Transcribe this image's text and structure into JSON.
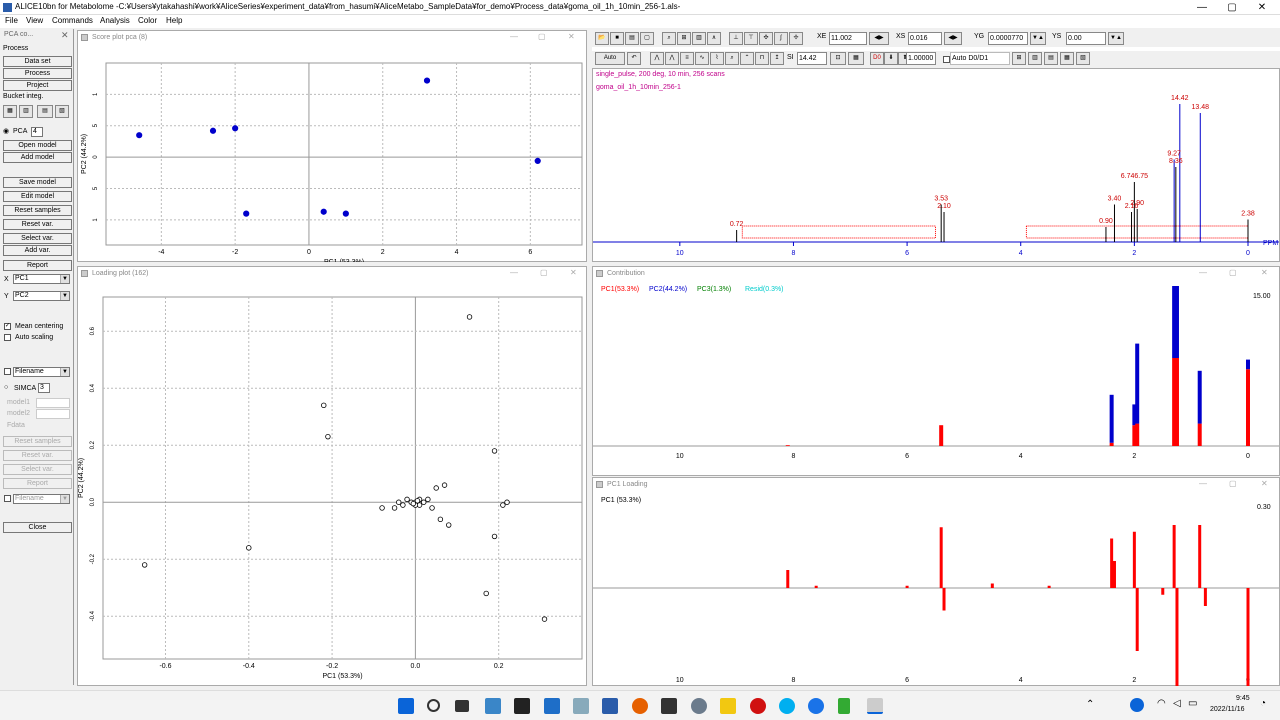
{
  "app": {
    "title": "ALICE10bn for Metabolome -C:¥Users¥ytakahashi¥work¥AliceSeries¥experiment_data¥from_hasumi¥AliceMetabo_SampleData¥for_demo¥Process_data¥goma_oil_1h_10min_256-1.als-"
  },
  "window_controls": {
    "minimize": "—",
    "maximize": "▢",
    "close": "✕"
  },
  "menu": [
    "File",
    "View",
    "Commands",
    "Analysis",
    "Color",
    "Help"
  ],
  "left_panel": {
    "title": "PCA co...",
    "process_label": "Process",
    "btn_dataset": "Data set",
    "btn_process": "Process",
    "btn_project": "Project",
    "bucket_label": "Bucket integ.",
    "pca_label": "PCA",
    "pca_value": "4",
    "btn_open_model": "Open model",
    "btn_add_model": "Add model",
    "btn_save_model": "Save model",
    "btn_edit_model": "Edit model",
    "btn_reset_samples": "Reset samples",
    "btn_reset_var": "Reset var.",
    "btn_select_var": "Select var.",
    "btn_add_var": "Add var.",
    "btn_report": "Report",
    "x_label": "X",
    "x_value": "PC1",
    "y_label": "Y",
    "y_value": "PC2",
    "mean_centering": "Mean centering",
    "auto_scaling": "Auto scaling",
    "filename1": "Filename",
    "simca_label": "SIMCA",
    "simca_value": "3",
    "model1": "model1",
    "model2": "model2",
    "fdata": "Fdata",
    "btn_reset_samples2": "Reset samples",
    "btn_reset_var2": "Reset var.",
    "btn_select_var2": "Select var.",
    "btn_report2": "Report",
    "filename2": "Filename",
    "btn_close": "Close"
  },
  "score_plot": {
    "title": "Score plot pca (8)",
    "chart_data": {
      "type": "scatter",
      "xlabel": "PC1 (53.3%)",
      "ylabel": "PC2 (44.2%)",
      "xlim": [
        -5.5,
        7.4
      ],
      "ylim": [
        -1.4,
        1.5
      ],
      "xticks": [
        -4,
        -2,
        0,
        2,
        4,
        6
      ],
      "yticks": [
        1,
        0.5,
        0,
        -0.5,
        -1
      ],
      "ytick_labels": [
        "1",
        "5",
        "0",
        "5",
        "1"
      ],
      "points": [
        [
          3.2,
          1.22
        ],
        [
          -4.6,
          0.35
        ],
        [
          -2.6,
          0.42
        ],
        [
          -2.0,
          0.46
        ],
        [
          6.2,
          -0.06
        ],
        [
          -1.7,
          -0.9
        ],
        [
          0.4,
          -0.87
        ],
        [
          1.0,
          -0.9
        ]
      ],
      "color": "#0000cc"
    }
  },
  "loading_plot": {
    "title": "Loading plot (162)",
    "chart_data": {
      "type": "scatter",
      "xlabel": "PC1 (53.3%)",
      "ylabel": "PC2 (44.2%)",
      "xlim": [
        -0.75,
        0.4
      ],
      "ylim": [
        -0.55,
        0.72
      ],
      "xticks": [
        -0.6,
        -0.4,
        -0.2,
        0.0,
        0.2
      ],
      "xtick_labels": [
        "-0.6",
        "-0.4",
        "-0.2",
        "0.0",
        "0.2"
      ],
      "yticks": [
        0.6,
        0.4,
        0.2,
        0.0,
        -0.2,
        -0.4
      ],
      "ytick_labels": [
        "0.6",
        "0.4",
        "0.2",
        "0.0",
        "-0.2",
        "-0.4"
      ],
      "points": [
        [
          0.13,
          0.65
        ],
        [
          -0.22,
          0.34
        ],
        [
          -0.21,
          0.23
        ],
        [
          0.19,
          0.18
        ],
        [
          -0.4,
          -0.16
        ],
        [
          -0.65,
          -0.22
        ],
        [
          0.19,
          -0.12
        ],
        [
          0.17,
          -0.32
        ],
        [
          0.31,
          -0.41
        ],
        [
          0.07,
          0.06
        ],
        [
          0.05,
          0.05
        ],
        [
          0.22,
          0.0
        ],
        [
          0.21,
          -0.01
        ],
        [
          0.08,
          -0.08
        ],
        [
          0.06,
          -0.06
        ],
        [
          0.04,
          -0.02
        ],
        [
          0.03,
          0.01
        ],
        [
          0.02,
          0.0
        ],
        [
          0.01,
          -0.01
        ],
        [
          0.0,
          0.0
        ],
        [
          -0.01,
          0.0
        ],
        [
          -0.02,
          0.01
        ],
        [
          -0.03,
          -0.01
        ],
        [
          -0.05,
          -0.02
        ],
        [
          -0.08,
          -0.02
        ],
        [
          -0.04,
          0.0
        ],
        [
          0.01,
          0.01
        ],
        [
          0.0,
          -0.01
        ],
        [
          0.005,
          0.005
        ],
        [
          -0.005,
          -0.005
        ]
      ]
    }
  },
  "toolbar": {
    "xe_label": "XE",
    "xe_value": "11.002",
    "xs_label": "XS",
    "xs_value": "0.016",
    "yg_label": "YG",
    "yg_value": "0.0000770",
    "ys_label": "YS",
    "ys_value": "0.00",
    "auto_label": "Auto",
    "scale_value": "14.42",
    "factor_value": "1.00000",
    "auto_d0": "Auto D0/D1",
    "d0": "D0"
  },
  "spectrum": {
    "line1": "single_pulse,  200 deg,  10 min, 256 scans",
    "line2": "goma_oil_1h_10min_256-1",
    "ppm_label": "PPM",
    "xticks": [
      10,
      8,
      6,
      4,
      2,
      0
    ],
    "peaks": [
      {
        "ppm": 1.2,
        "label": "14.42",
        "h": 0.92
      },
      {
        "ppm": 0.84,
        "label": "13.48",
        "h": 0.86
      },
      {
        "ppm": 1.3,
        "label": "9.27",
        "h": 0.55
      },
      {
        "ppm": 1.27,
        "label": "8.36",
        "h": 0.5
      },
      {
        "ppm": 2.0,
        "label": "6.746.75",
        "h": 0.4
      },
      {
        "ppm": 5.4,
        "label": "3.53",
        "h": 0.25
      },
      {
        "ppm": 5.35,
        "label": "2.10",
        "h": 0.2
      },
      {
        "ppm": 2.35,
        "label": "3.40",
        "h": 0.25
      },
      {
        "ppm": 2.05,
        "label": "2.16",
        "h": 0.2
      },
      {
        "ppm": 1.95,
        "label": "2.90",
        "h": 0.22
      },
      {
        "ppm": 0.0,
        "label": "2.38",
        "h": 0.15
      },
      {
        "ppm": 9.0,
        "label": "0.72",
        "h": 0.08
      },
      {
        "ppm": 2.5,
        "label": "0.90",
        "h": 0.1
      }
    ]
  },
  "contribution": {
    "title": "Contribution",
    "legend": [
      {
        "label": "PC1(53.3%)",
        "color": "#ff0000"
      },
      {
        "label": "PC2(44.2%)",
        "color": "#0000cc"
      },
      {
        "label": "PC3(1.3%)",
        "color": "#008000"
      },
      {
        "label": "Resid(0.3%)",
        "color": "#00cccc"
      }
    ],
    "ymax_label": "15.00",
    "xticks": [
      10,
      8,
      6,
      4,
      2,
      0
    ],
    "chart_data": {
      "type": "bar",
      "x": [
        8.1,
        5.4,
        2.4,
        2.0,
        1.95,
        1.3,
        1.25,
        0.85,
        0.0
      ],
      "pc1": [
        0.005,
        0.13,
        0.02,
        0.13,
        0.14,
        0.55,
        0.55,
        0.14,
        0.48
      ],
      "pc2": [
        0.0,
        0.0,
        0.3,
        0.13,
        0.5,
        0.45,
        0.45,
        0.33,
        0.06
      ]
    }
  },
  "pc1_loading": {
    "title": "PC1 Loading",
    "legend": "PC1 (53.3%)",
    "ymax_label": "0.30",
    "xticks": [
      10,
      8,
      6,
      4,
      2,
      0
    ],
    "chart_data": {
      "type": "bar",
      "x": [
        8.1,
        7.6,
        6.0,
        5.4,
        5.35,
        4.5,
        3.5,
        2.4,
        2.35,
        2.0,
        1.95,
        1.5,
        1.3,
        1.25,
        0.85,
        0.75,
        0.0
      ],
      "values": [
        0.08,
        0.01,
        0.01,
        0.27,
        -0.1,
        0.02,
        0.01,
        0.22,
        0.12,
        0.25,
        -0.28,
        -0.03,
        0.28,
        -0.55,
        0.28,
        -0.08,
        -0.55
      ]
    }
  },
  "taskbar": {
    "time": "9:45",
    "date": "2022/11/16"
  }
}
